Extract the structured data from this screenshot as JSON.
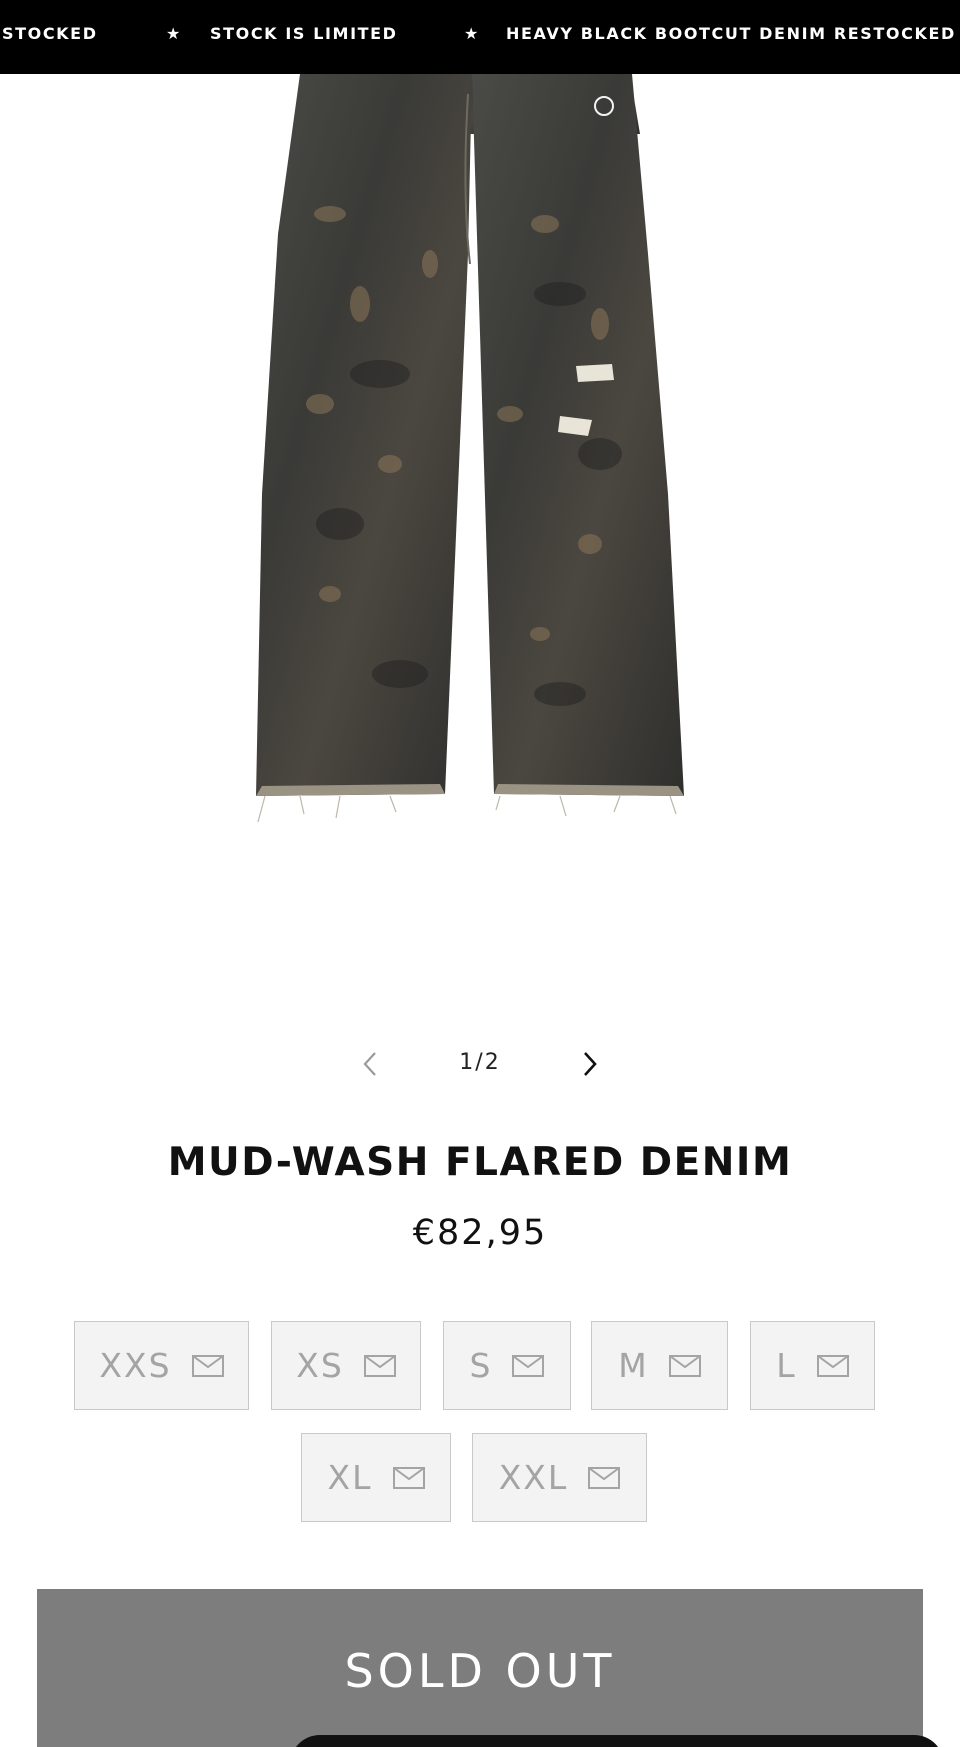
{
  "announcement": {
    "messages": [
      "STOCKED",
      "STOCK IS LIMITED",
      "HEAVY BLACK BOOTCUT DENIM RESTOCKED"
    ],
    "separator": "★"
  },
  "gallery": {
    "image_alt": "Mud-wash flared denim jeans",
    "pager": {
      "current": "1/2"
    },
    "prev_icon": "chevron-left-icon",
    "next_icon": "chevron-right-icon"
  },
  "product": {
    "title": "MUD-WASH FLARED DENIM",
    "price": "€82,95"
  },
  "sizes": {
    "items": [
      {
        "label": "XXS",
        "icon": "mail-icon"
      },
      {
        "label": "XS",
        "icon": "mail-icon"
      },
      {
        "label": "S",
        "icon": "mail-icon"
      },
      {
        "label": "M",
        "icon": "mail-icon"
      },
      {
        "label": "L",
        "icon": "mail-icon"
      },
      {
        "label": "XL",
        "icon": "mail-icon"
      },
      {
        "label": "XXL",
        "icon": "mail-icon"
      }
    ]
  },
  "cta": {
    "label": "SOLD OUT"
  },
  "colors": {
    "announce_bg": "#000000",
    "size_bg": "#f3f3f3",
    "size_text": "#a4a4a4",
    "soldout_bg": "#7d7d7d"
  }
}
